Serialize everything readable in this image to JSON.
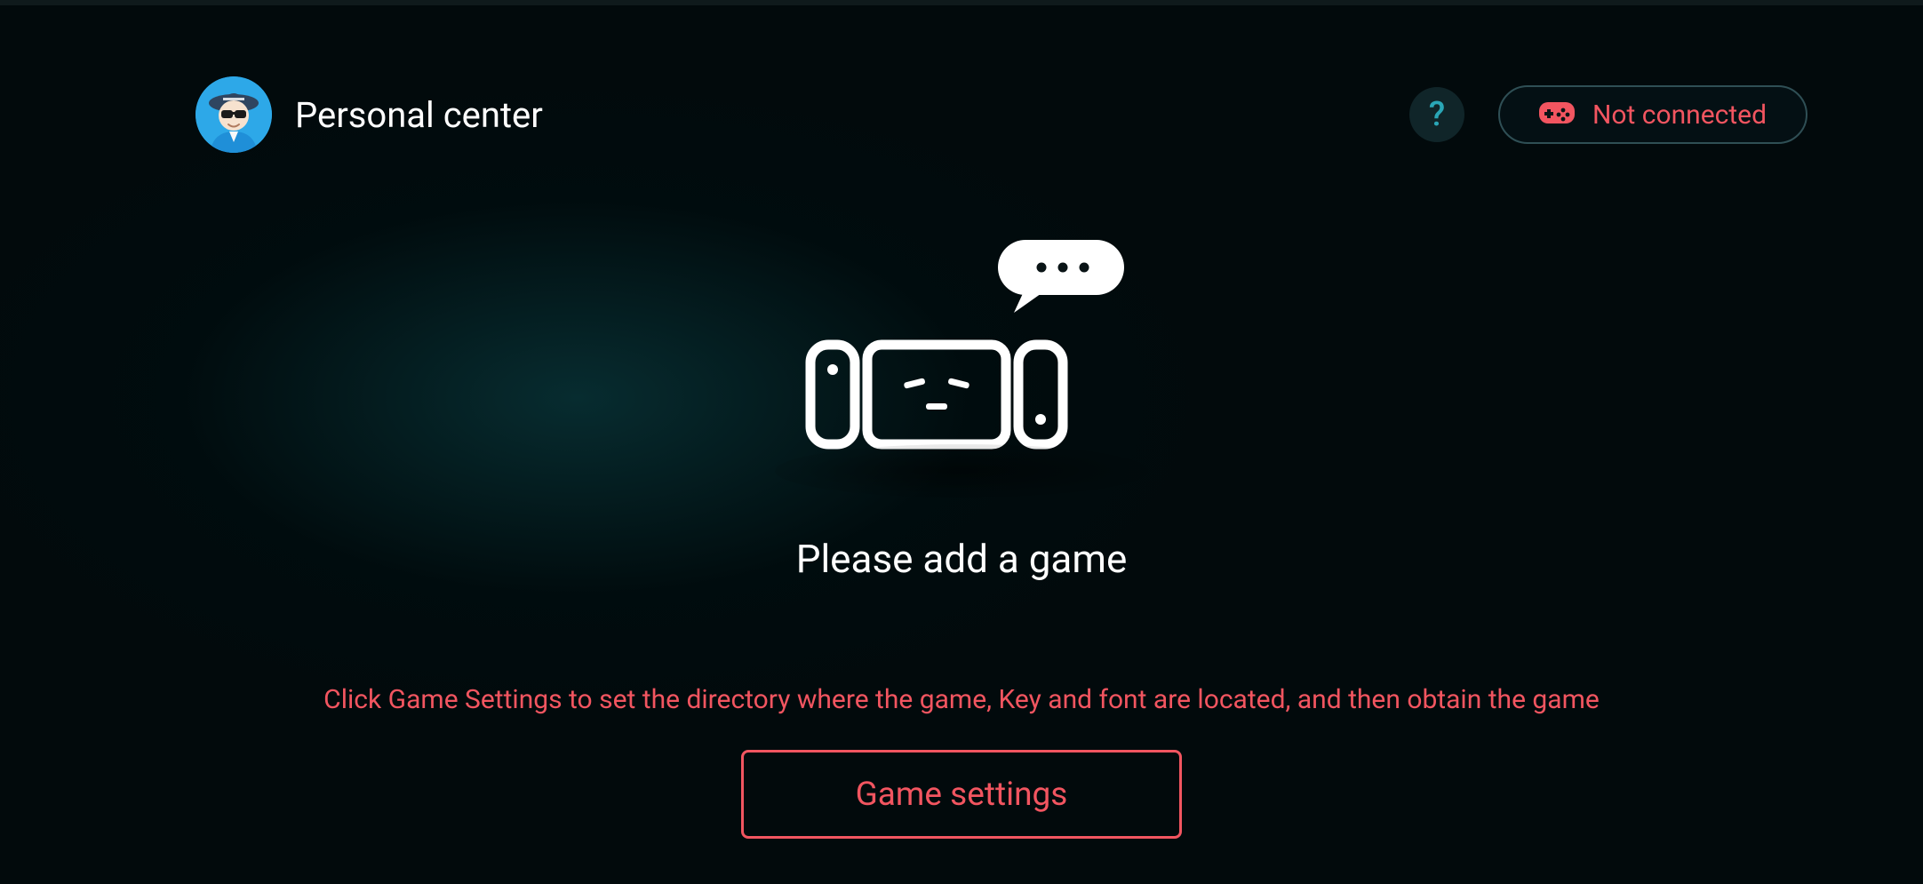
{
  "header": {
    "title": "Personal center",
    "help_icon": "?",
    "connection": {
      "icon": "gamepad-icon",
      "label": "Not connected"
    }
  },
  "empty_state": {
    "illustration": "console-speech-icon",
    "title": "Please add a game",
    "hint": "Click Game Settings to set the directory where the game, Key and font are located, and then obtain the game",
    "button_label": "Game settings"
  },
  "colors": {
    "accent": "#f25560",
    "help": "#2aa6b6"
  }
}
